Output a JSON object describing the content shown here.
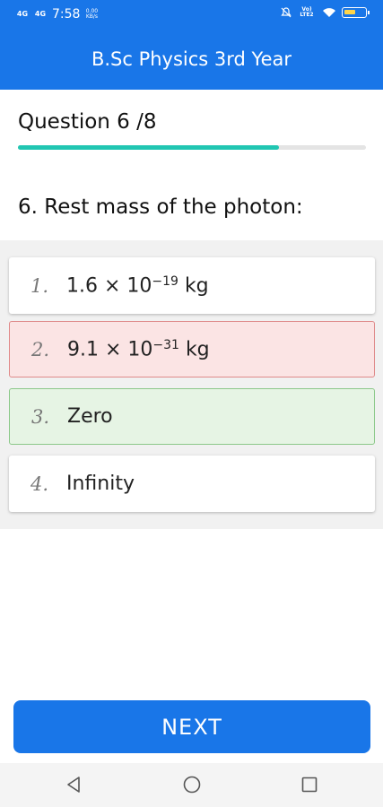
{
  "status_bar": {
    "signal_1": "4G",
    "signal_2": "4G",
    "time": "7:58",
    "net_speed": "0.00 KB/s",
    "volte": "Vo) LTE2",
    "icons": [
      "mute-icon",
      "wifi-icon",
      "battery-icon"
    ],
    "battery_level": 0.5
  },
  "app_bar": {
    "title": "B.Sc Physics 3rd Year",
    "color": "#1976e8"
  },
  "quiz": {
    "progress_label": "Question 6 /8",
    "current": 6,
    "total": 8,
    "progress_fraction": 0.75,
    "progress_color": "#21c6b2",
    "question_text": "6. Rest mass of the photon:"
  },
  "options": [
    {
      "number": "1.",
      "mantissa": "1.6 × 10",
      "exponent": "−19",
      "unit": " kg",
      "state": "normal"
    },
    {
      "number": "2.",
      "mantissa": "9.1 × 10",
      "exponent": "−31",
      "unit": " kg",
      "state": "wrong"
    },
    {
      "number": "3.",
      "text": "Zero",
      "state": "correct"
    },
    {
      "number": "4.",
      "text": "Infinity",
      "state": "normal"
    }
  ],
  "state_colors": {
    "wrong": "#fbe4e4",
    "correct": "#e6f4e4"
  },
  "next_button": {
    "label": "NEXT"
  },
  "nav_bar": {
    "icons": [
      "back-triangle-icon",
      "home-circle-icon",
      "recents-square-icon"
    ]
  }
}
